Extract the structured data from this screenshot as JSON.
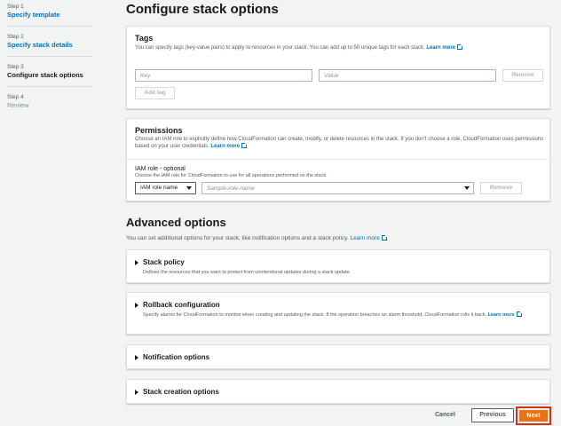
{
  "wizard": {
    "steps": [
      {
        "num": "Step 1",
        "label": "Specify template"
      },
      {
        "num": "Step 2",
        "label": "Specify stack details"
      },
      {
        "num": "Step 3",
        "label": "Configure stack options"
      },
      {
        "num": "Step 4",
        "label": "Review"
      }
    ]
  },
  "page": {
    "title": "Configure stack options"
  },
  "tags": {
    "title": "Tags",
    "desc": "You can specify tags (key-value pairs) to apply to resources in your stack. You can add up to 50 unique tags for each stack.",
    "learn_more": "Learn more",
    "key_placeholder": "Key",
    "value_placeholder": "Value",
    "remove_label": "Remove",
    "add_tag_label": "Add tag"
  },
  "permissions": {
    "title": "Permissions",
    "desc_line1": "Choose an IAM role to explicitly define how CloudFormation can create, modify, or delete resources in the stack. If you don't choose a role, CloudFormation uses permissions",
    "desc_line2": "based on your user credentials.",
    "learn_more": "Learn more",
    "iam_label": "IAM role - optional",
    "iam_desc": "Choose the IAM role for CloudFormation to use for all operations performed on the stack.",
    "role_type": "IAM role name",
    "role_placeholder": "Sample-role-name",
    "remove_label": "Remove"
  },
  "advanced": {
    "heading": "Advanced options",
    "desc": "You can set additional options for your stack, like notification options and a stack policy.",
    "learn_more": "Learn more",
    "stack_policy": {
      "title": "Stack policy",
      "desc": "Defines the resources that you want to protect from unintentional updates during a stack update."
    },
    "rollback": {
      "title": "Rollback configuration",
      "desc": "Specify alarms for CloudFormation to monitor when creating and updating the stack. If the operation breaches an alarm threshold, CloudFormation rolls it back.",
      "learn_more_1": "Learn",
      "learn_more_2": "more"
    },
    "notification": {
      "title": "Notification options"
    },
    "creation": {
      "title": "Stack creation options"
    }
  },
  "footer": {
    "cancel": "Cancel",
    "previous": "Previous",
    "next": "Next"
  }
}
